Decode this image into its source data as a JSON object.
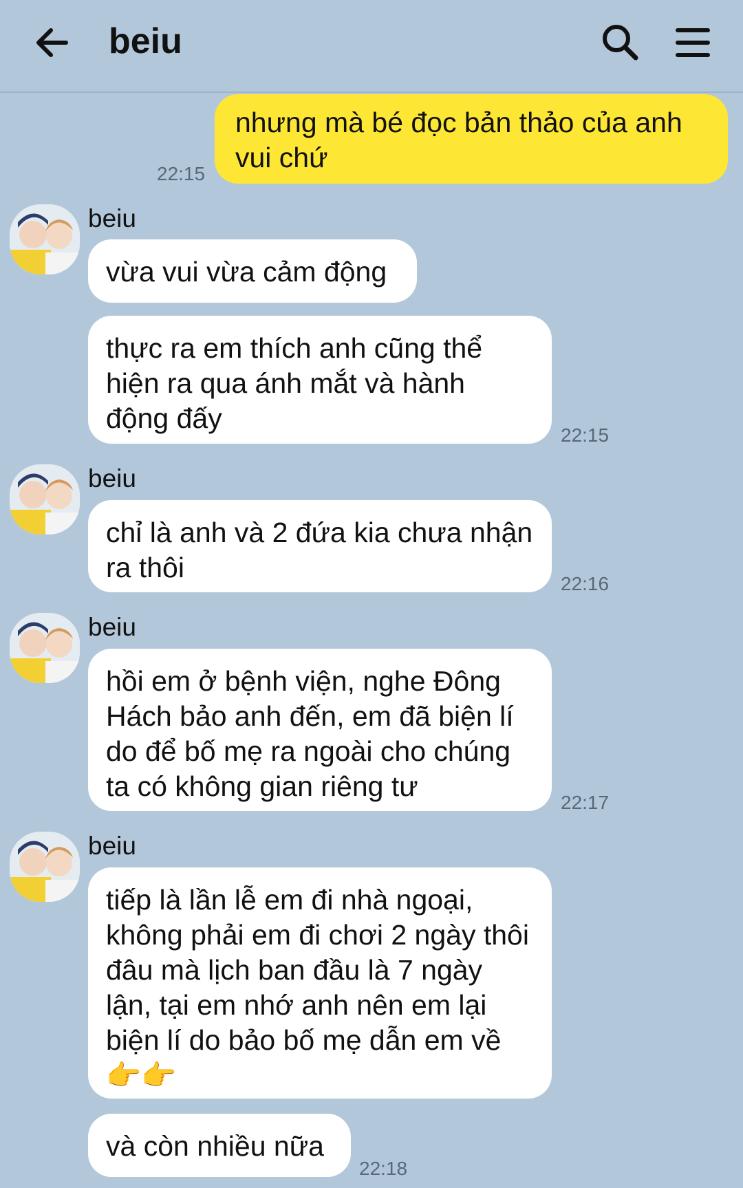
{
  "header": {
    "title": "beiu",
    "back_icon": "arrow-left-icon",
    "search_icon": "search-icon",
    "menu_icon": "menu-icon"
  },
  "messages": [
    {
      "from": "me",
      "text": "nhưng mà bé đọc bản thảo của anh vui chứ",
      "time": "22:15"
    },
    {
      "from": "beiu",
      "sender": "beiu",
      "text": "vừa vui vừa cảm động"
    },
    {
      "from": "beiu",
      "text": "thực ra em thích anh cũng thể hiện ra qua ánh mắt và hành động đấy",
      "time": "22:15"
    },
    {
      "from": "beiu",
      "sender": "beiu",
      "text": "chỉ là anh và 2 đứa kia chưa nhận ra thôi",
      "time": "22:16"
    },
    {
      "from": "beiu",
      "sender": "beiu",
      "text": "hồi em ở bệnh viện, nghe Đông Hách bảo anh đến, em đã biện lí do để bố mẹ ra ngoài cho chúng ta có không gian riêng tư",
      "time": "22:17"
    },
    {
      "from": "beiu",
      "sender": "beiu",
      "text": "tiếp là lần lễ em đi nhà ngoại, không phải em đi chơi 2 ngày thôi đâu mà lịch ban đầu là 7 ngày lận, tại em nhớ anh nên em lại biện lí do bảo bố mẹ dẫn em về👉👉"
    },
    {
      "from": "beiu",
      "text": "và còn nhiều nữa",
      "time": "22:18"
    }
  ],
  "colors": {
    "background": "#b3c7db",
    "outgoing_bubble": "#fee734",
    "incoming_bubble": "#ffffff"
  }
}
